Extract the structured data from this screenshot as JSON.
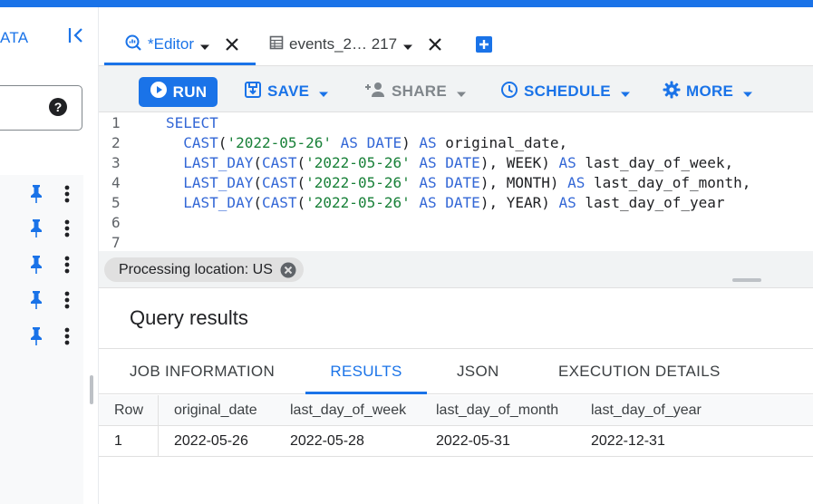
{
  "left_panel": {
    "explorer_label": "ATA",
    "pinned_rows": 5
  },
  "tabs": [
    {
      "label": "*Editor",
      "icon": "query-icon"
    },
    {
      "label": "events_2… 217",
      "icon": "table-icon"
    }
  ],
  "toolbar": {
    "run": "RUN",
    "save": "SAVE",
    "share": "SHARE",
    "schedule": "SCHEDULE",
    "more": "MORE"
  },
  "editor": {
    "line_numbers": [
      "1",
      "2",
      "3",
      "4",
      "5",
      "6",
      "7"
    ],
    "lines": [
      "SELECT",
      "  CAST('2022-05-26' AS DATE) AS original_date,",
      "  LAST_DAY(CAST('2022-05-26' AS DATE), WEEK) AS last_day_of_week,",
      "  LAST_DAY(CAST('2022-05-26' AS DATE), MONTH) AS last_day_of_month,",
      "  LAST_DAY(CAST('2022-05-26' AS DATE), YEAR) AS last_day_of_year",
      "",
      ""
    ],
    "processing_location": "Processing location: US"
  },
  "results": {
    "title": "Query results",
    "tabs": [
      "JOB INFORMATION",
      "RESULTS",
      "JSON",
      "EXECUTION DETAILS"
    ],
    "active_tab": "RESULTS",
    "columns": [
      "Row",
      "original_date",
      "last_day_of_week",
      "last_day_of_month",
      "last_day_of_year"
    ],
    "rows": [
      [
        "1",
        "2022-05-26",
        "2022-05-28",
        "2022-05-31",
        "2022-12-31"
      ]
    ]
  },
  "colors": {
    "accent": "#1a73e8",
    "keyword": "#3367d6",
    "string": "#188038"
  }
}
